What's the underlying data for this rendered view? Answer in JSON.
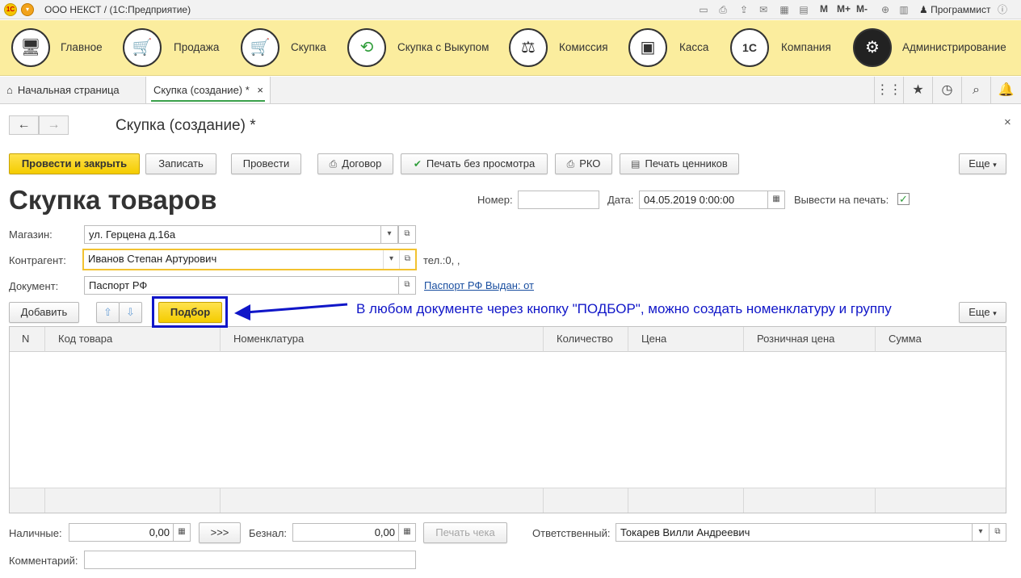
{
  "titlebar": {
    "app_title": "ООО НЕКСТ /  (1С:Предприятие)",
    "buttons": [
      "M",
      "M+",
      "M-"
    ],
    "user": "Программист"
  },
  "sections": [
    {
      "label": "Главное",
      "icon": "computer-icon"
    },
    {
      "label": "Продажа",
      "icon": "cart-up-icon"
    },
    {
      "label": "Скупка",
      "icon": "cart-down-icon"
    },
    {
      "label": "Скупка с Выкупом",
      "icon": "cycle-arrows-icon"
    },
    {
      "label": "Комиссия",
      "icon": "scales-icon"
    },
    {
      "label": "Касса",
      "icon": "cash-register-icon"
    },
    {
      "label": "Компания",
      "icon": "1c-logo-icon"
    },
    {
      "label": "Администрирование",
      "icon": "gears-icon"
    }
  ],
  "tabs": {
    "home": "Начальная страница",
    "active": "Скупка (создание) *"
  },
  "form": {
    "title": "Скупка (создание) *",
    "heading": "Скупка товаров"
  },
  "toolbar": {
    "post_close": "Провести и закрыть",
    "save": "Записать",
    "post": "Провести",
    "contract": "Договор",
    "print_no_preview": "Печать без просмотра",
    "rko": "РКО",
    "print_prices": "Печать ценников",
    "more": "Еще"
  },
  "header_fields": {
    "number_label": "Номер:",
    "number_value": "",
    "date_label": "Дата:",
    "date_value": "04.05.2019  0:00:00",
    "print_label": "Вывести на печать:"
  },
  "fields": {
    "shop_label": "Магазин:",
    "shop_value": "ул. Герцена д.16а",
    "counterparty_label": "Контрагент:",
    "counterparty_value": "Иванов Степан Артурович",
    "phone": "тел.:0, ,",
    "document_label": "Документ:",
    "document_value": "Паспорт РФ",
    "document_link": "Паспорт РФ   Выдан:   от"
  },
  "table_toolbar": {
    "add": "Добавить",
    "pick": "Подбор",
    "more": "Еще"
  },
  "table": {
    "columns": [
      "N",
      "Код товара",
      "Номенклатура",
      "Количество",
      "Цена",
      "Розничная цена",
      "Сумма"
    ]
  },
  "annotation": "В любом документе через кнопку \"ПОДБОР\", можно создать номенклатуру и группу",
  "footer": {
    "cash_label": "Наличные:",
    "cash_value": "0,00",
    "transfer_button": ">>>",
    "cashless_label": "Безнал:",
    "cashless_value": "0,00",
    "print_receipt": "Печать чека",
    "responsible_label": "Ответственный:",
    "responsible_value": "Токарев Вилли Андреевич",
    "comment_label": "Комментарий:",
    "comment_value": ""
  },
  "colors": {
    "sections_bg": "#fbed9e",
    "primary_button": "#f4cc00",
    "annotation": "#1016c8",
    "link": "#1a4fa0"
  }
}
